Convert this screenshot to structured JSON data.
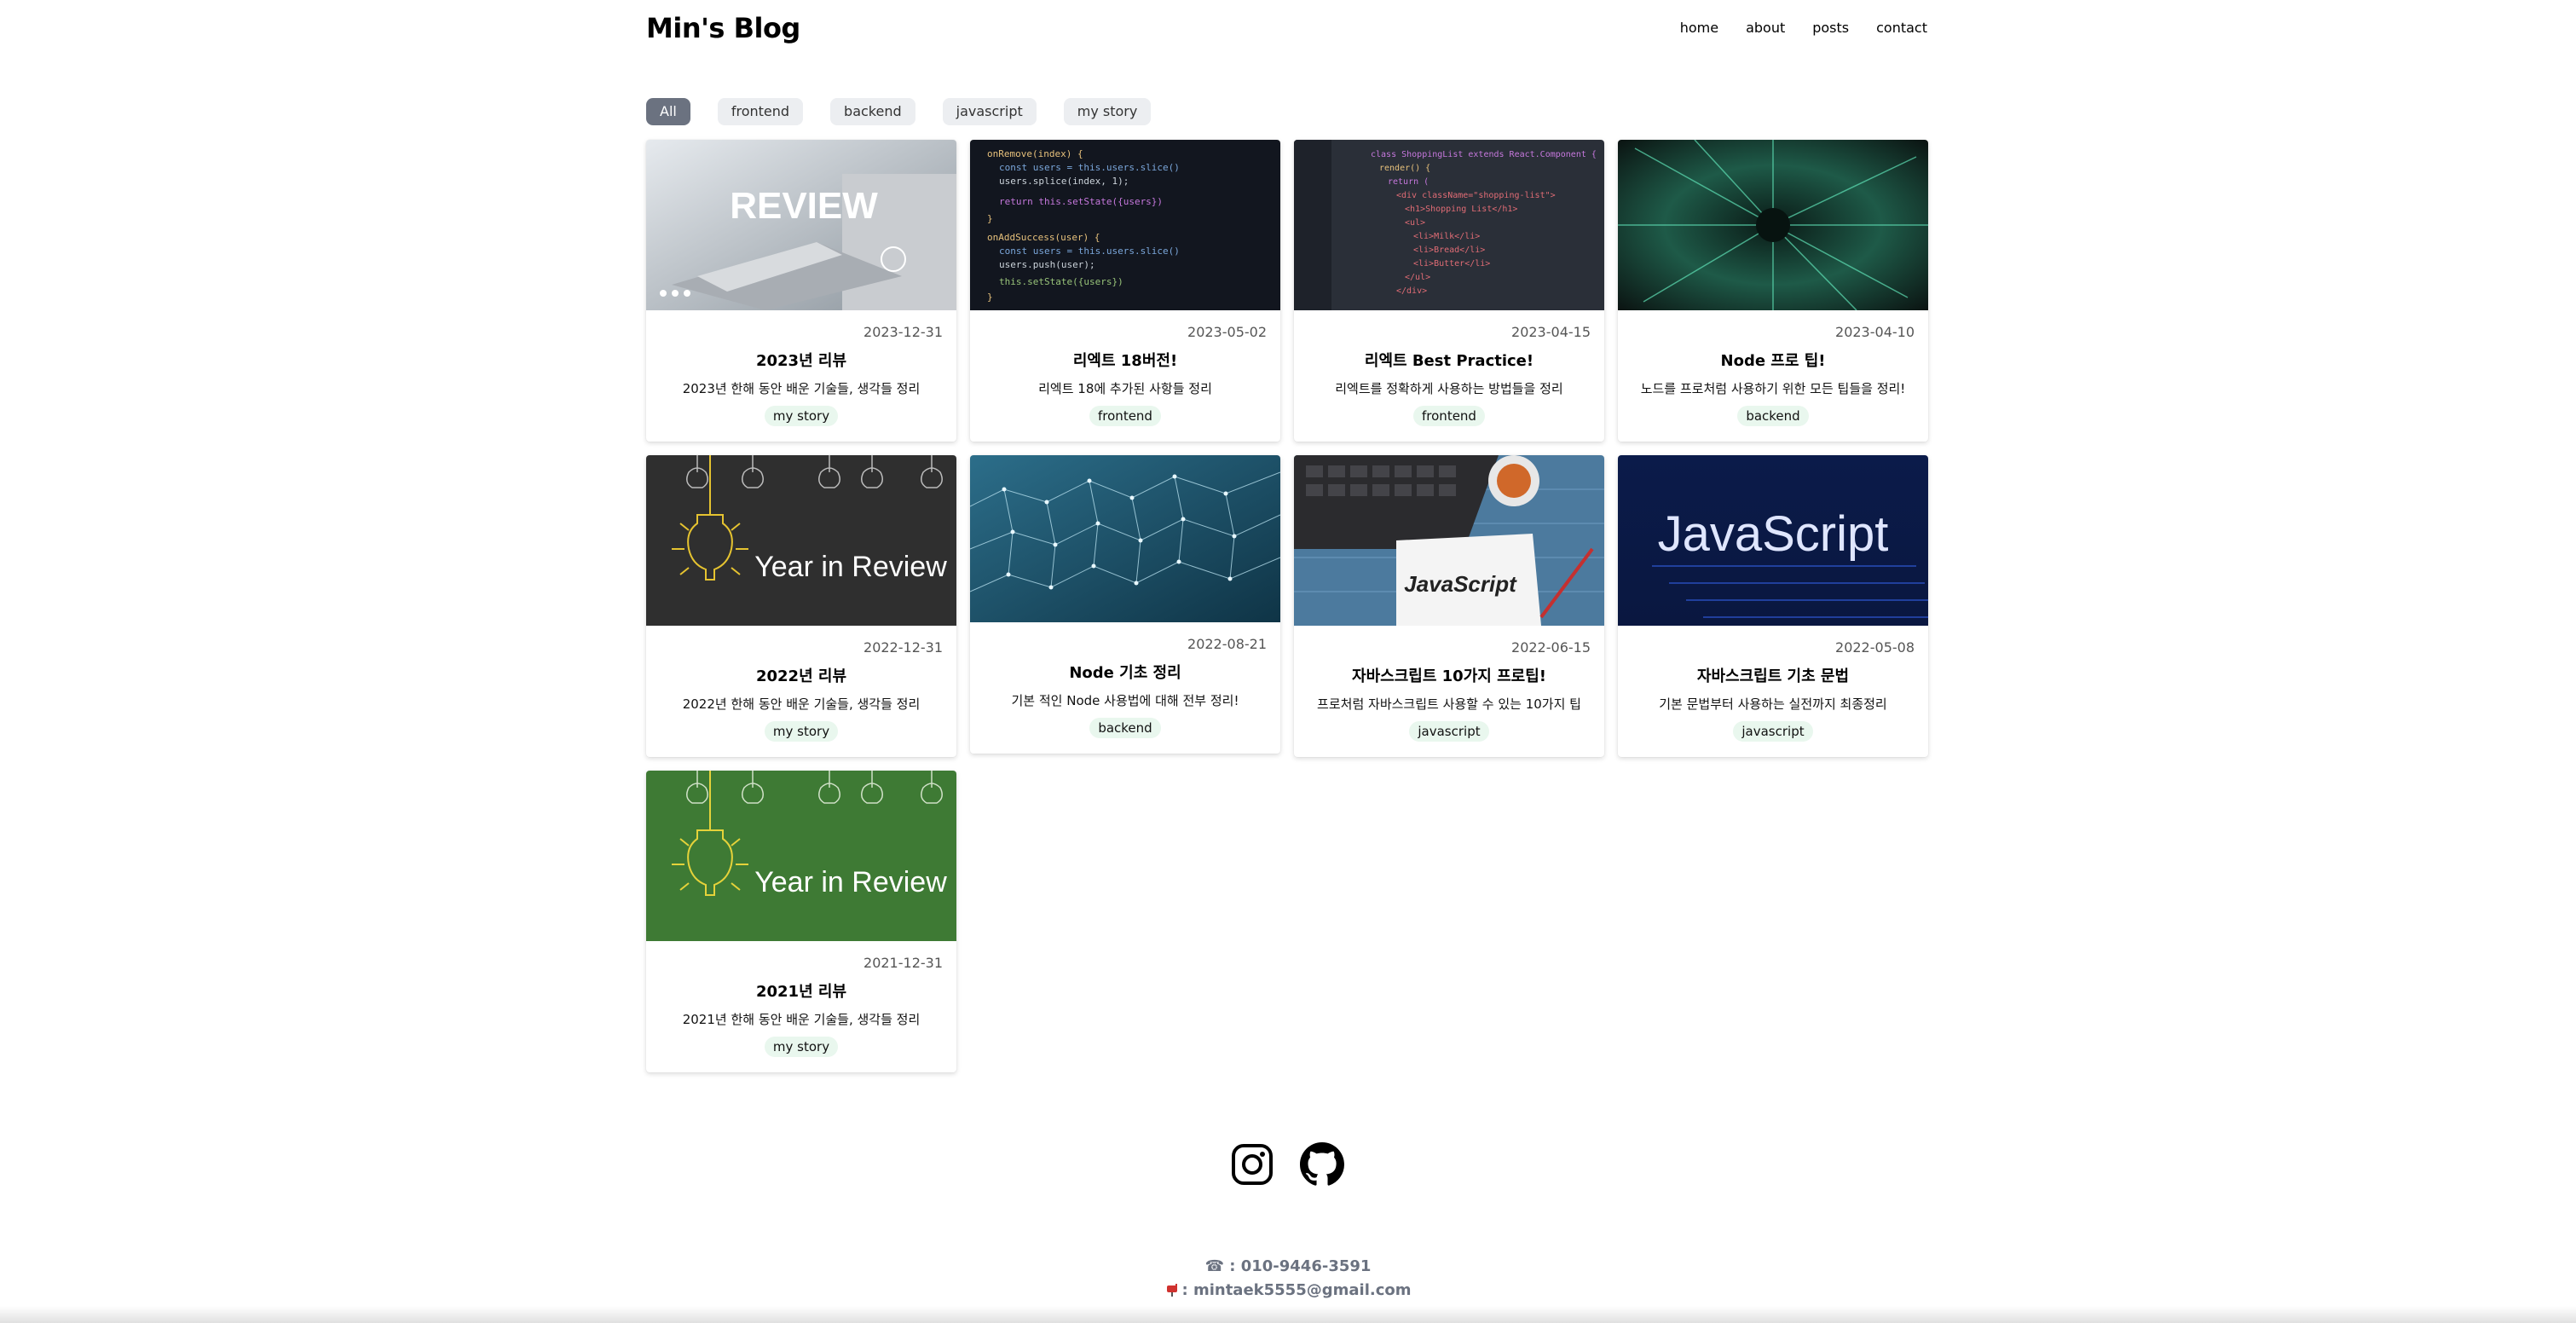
{
  "header": {
    "logo": "Min's Blog",
    "nav": [
      "home",
      "about",
      "posts",
      "contact"
    ]
  },
  "filters": {
    "selected": "All",
    "items": [
      "All",
      "frontend",
      "backend",
      "javascript",
      "my story"
    ]
  },
  "posts": [
    {
      "date": "2023-12-31",
      "title": "2023년 리뷰",
      "desc": "2023년 한해 동안 배운 기술들, 생각들 정리",
      "tag": "my story",
      "image_text": "REVIEW"
    },
    {
      "date": "2023-05-02",
      "title": "리엑트 18버전!",
      "desc": "리엑트 18에 추가된 사항들 정리",
      "tag": "frontend",
      "image_text": ""
    },
    {
      "date": "2023-04-15",
      "title": "리엑트 Best Practice!",
      "desc": "리엑트를 정확하게 사용하는 방법들을 정리",
      "tag": "frontend",
      "image_text": ""
    },
    {
      "date": "2023-04-10",
      "title": "Node 프로 팁!",
      "desc": "노드를 프로처럼 사용하기 위한 모든 팁들을 정리!",
      "tag": "backend",
      "image_text": ""
    },
    {
      "date": "2022-12-31",
      "title": "2022년 리뷰",
      "desc": "2022년 한해 동안 배운 기술들, 생각들 정리",
      "tag": "my story",
      "image_text": "Year in Review"
    },
    {
      "date": "2022-08-21",
      "title": "Node 기초 정리",
      "desc": "기본 적인 Node 사용법에 대해 전부 정리!",
      "tag": "backend",
      "image_text": ""
    },
    {
      "date": "2022-06-15",
      "title": "자바스크립트 10가지 프로팁!",
      "desc": "프로처럼 자바스크립트 사용할 수 있는 10가지 팁",
      "tag": "javascript",
      "image_text": "JavaScript"
    },
    {
      "date": "2022-05-08",
      "title": "자바스크립트 기초 문법",
      "desc": "기본 문법부터 사용하는 실전까지 최종정리",
      "tag": "javascript",
      "image_text": "JavaScript"
    },
    {
      "date": "2021-12-31",
      "title": "2021년 리뷰",
      "desc": "2021년 한해 동안 배운 기술들, 생각들 정리",
      "tag": "my story",
      "image_text": "Year in Review"
    }
  ],
  "footer": {
    "icons": [
      "instagram-icon",
      "github-icon"
    ],
    "phone": "☎ : 010-9446-3591",
    "email_label": ": mintaek5555@gmail.com"
  },
  "colors": {
    "chip_active": "#6b7280",
    "tag_bg": "#e9f7ee"
  }
}
